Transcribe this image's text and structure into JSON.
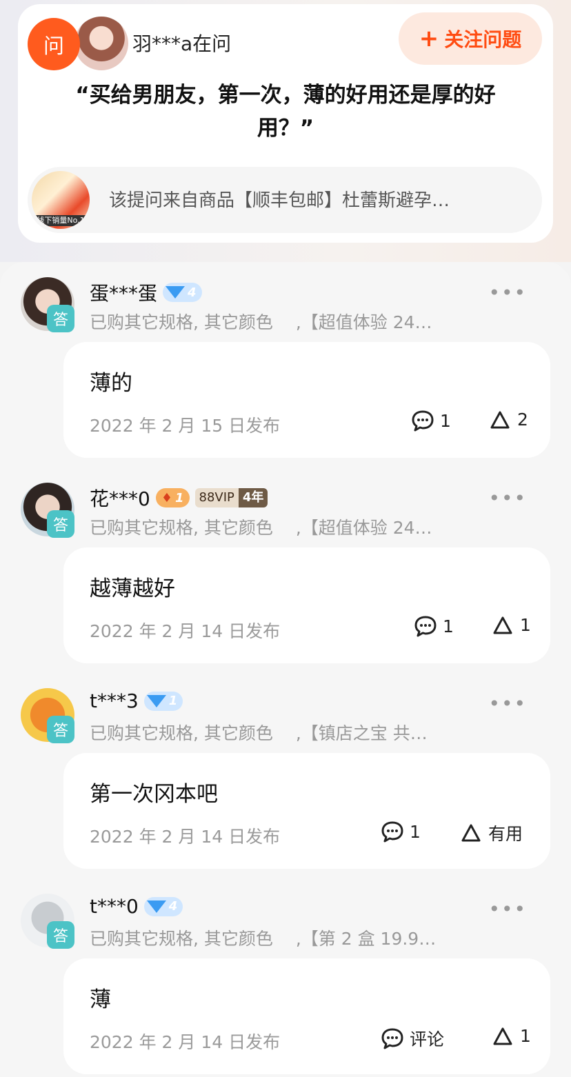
{
  "question": {
    "badge": "问",
    "asker": "羽***a在问",
    "follow_label": "关注问题",
    "follow_plus": "+",
    "text": "“买给男朋友，第一次，薄的好用还是厚的好用？”",
    "product_text": "该提问来自商品【顺丰包邮】杜蕾斯避孕…",
    "product_thumb_label": "线下销量No.1"
  },
  "answers": [
    {
      "name": "蛋***蛋",
      "level_badge": "4",
      "badge": "答",
      "spec": "已购其它规格, 其它颜色　 ,【超值体验 24…",
      "content": "薄的",
      "date": "2022 年 2 月 15 日发布",
      "comment": "1",
      "useful": "2",
      "more": "•••"
    },
    {
      "name": "花***0",
      "level_badge": "1",
      "vip_a": "88VIP",
      "vip_b": "4年",
      "badge": "答",
      "spec": "已购其它规格, 其它颜色　 ,【超值体验 24…",
      "content": "越薄越好",
      "date": "2022 年 2 月 14 日发布",
      "comment": "1",
      "useful": "1",
      "more": "•••"
    },
    {
      "name": "t***3",
      "level_badge": "1",
      "badge": "答",
      "spec": "已购其它规格, 其它颜色　 ,【镇店之宝 共…",
      "content": "第一次冈本吧",
      "date": "2022 年 2 月 14 日发布",
      "comment": "1",
      "useful": "有用",
      "more": "•••"
    },
    {
      "name": "t***0",
      "level_badge": "4",
      "badge": "答",
      "spec": "已购其它规格, 其它颜色　 ,【第 2 盒 19.9…",
      "content": "薄",
      "date": "2022 年 2 月 14 日发布",
      "comment": "评论",
      "useful": "1",
      "more": "•••"
    }
  ],
  "colors": {
    "accent": "#ff4c12",
    "answer_badge": "#4cc3c6",
    "diamond": "#3a9bf2"
  },
  "icons": [
    "comment-icon",
    "thumbs-up-icon",
    "more-icon",
    "plus-icon",
    "diamond-level-icon",
    "crown-level-icon"
  ]
}
